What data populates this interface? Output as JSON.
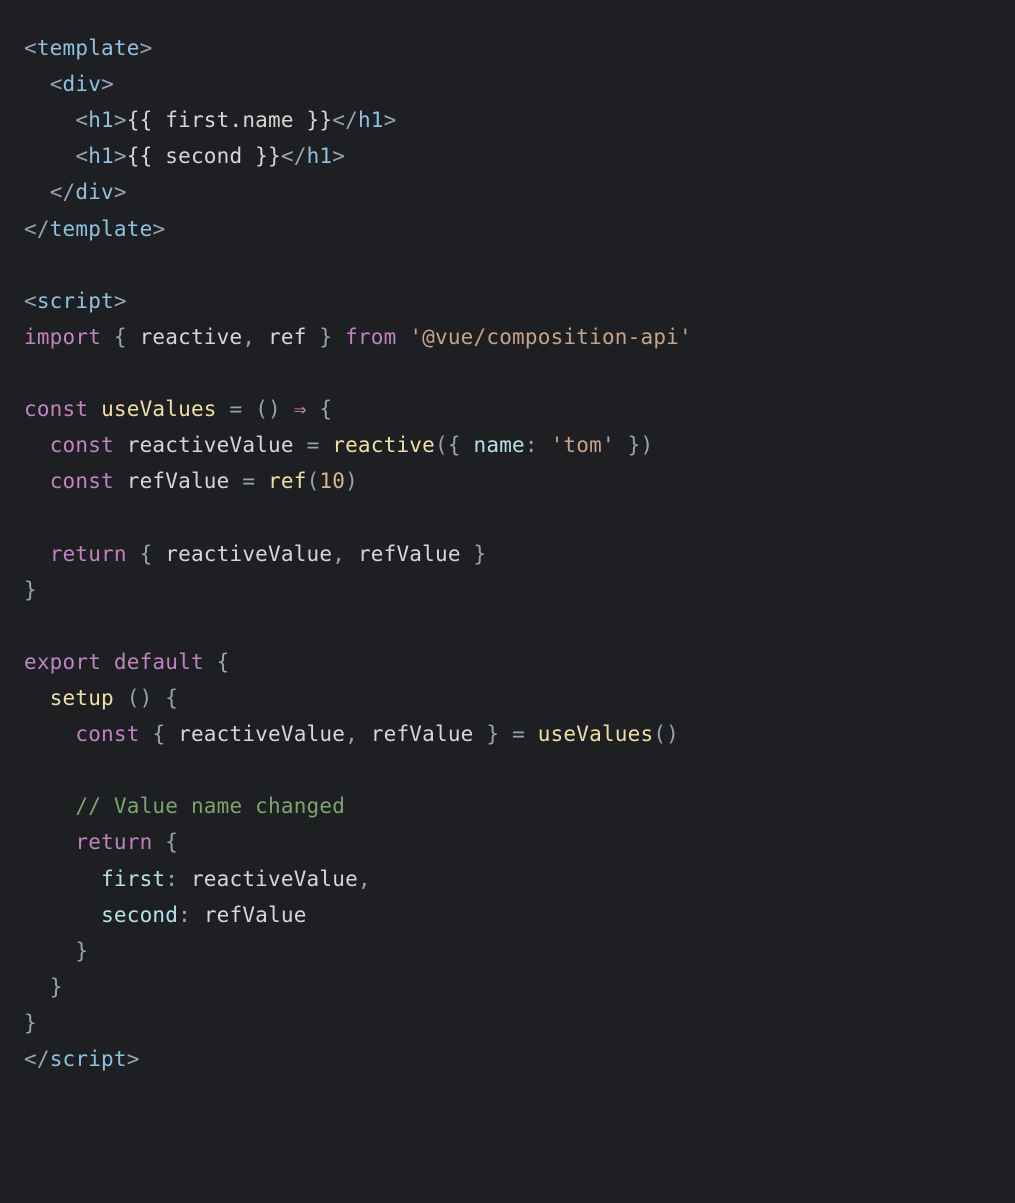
{
  "code": {
    "l1": {
      "p1": "<",
      "t1": "template",
      "p2": ">"
    },
    "l2": {
      "indent": "  ",
      "p1": "<",
      "t1": "div",
      "p2": ">"
    },
    "l3": {
      "indent": "    ",
      "p1": "<",
      "t1": "h1",
      "p2": ">",
      "m1": "{{ ",
      "v1": "first.name",
      "m2": " }}",
      "p3": "</",
      "t2": "h1",
      "p4": ">"
    },
    "l4": {
      "indent": "    ",
      "p1": "<",
      "t1": "h1",
      "p2": ">",
      "m1": "{{ ",
      "v1": "second",
      "m2": " }}",
      "p3": "</",
      "t2": "h1",
      "p4": ">"
    },
    "l5": {
      "indent": "  ",
      "p1": "</",
      "t1": "div",
      "p2": ">"
    },
    "l6": {
      "p1": "</",
      "t1": "template",
      "p2": ">"
    },
    "blank1": "",
    "l7": {
      "p1": "<",
      "t1": "script",
      "p2": ">"
    },
    "l8": {
      "kw": "import",
      "sp": " ",
      "p1": "{ ",
      "n1": "reactive",
      "c": ", ",
      "n2": "ref",
      "p2": " } ",
      "kw2": "from",
      "sp2": " ",
      "s": "'@vue/composition-api'"
    },
    "blank2": "",
    "l9": {
      "kw": "const",
      "sp": " ",
      "fn": "useValues",
      "sp2": " ",
      "op1": "=",
      "sp3": " ",
      "p1": "()",
      "sp4": " ",
      "arr": "⇒",
      "sp5": " ",
      "brace": "{"
    },
    "l10": {
      "indent": "  ",
      "kw": "const",
      "sp": " ",
      "id": "reactiveValue",
      "sp2": " ",
      "op": "=",
      "sp3": " ",
      "fn": "reactive",
      "p1": "({ ",
      "prop": "name",
      "p2": ": ",
      "str": "'tom'",
      "p3": " })"
    },
    "l11": {
      "indent": "  ",
      "kw": "const",
      "sp": " ",
      "id": "refValue",
      "sp2": " ",
      "op": "=",
      "sp3": " ",
      "fn": "ref",
      "p1": "(",
      "num": "10",
      "p2": ")"
    },
    "blank3": "",
    "l12": {
      "indent": "  ",
      "kw": "return",
      "sp": " ",
      "p1": "{ ",
      "n1": "reactiveValue",
      "c1": ", ",
      "n2": "refValue",
      "p2": " }"
    },
    "l13": {
      "p": "}"
    },
    "blank4": "",
    "l14": {
      "kw": "export",
      "sp": " ",
      "kw2": "default",
      "sp2": " ",
      "p": "{"
    },
    "l15": {
      "indent": "  ",
      "fn": "setup",
      "sp": " ",
      "p": "() {"
    },
    "l16": {
      "indent": "    ",
      "kw": "const",
      "sp": " ",
      "p1": "{ ",
      "n1": "reactiveValue",
      "c1": ", ",
      "n2": "refValue",
      "p2": " } ",
      "op": "=",
      "sp2": " ",
      "fn": "useValues",
      "p3": "()"
    },
    "blank5": "",
    "l17": {
      "indent": "    ",
      "c": "// Value name changed"
    },
    "l18": {
      "indent": "    ",
      "kw": "return",
      "sp": " ",
      "p": "{"
    },
    "l19": {
      "indent": "      ",
      "prop": "first",
      "p": ": ",
      "id": "reactiveValue",
      "c": ","
    },
    "l20": {
      "indent": "      ",
      "prop": "second",
      "p": ": ",
      "id": "refValue"
    },
    "l21": {
      "indent": "    ",
      "p": "}"
    },
    "l22": {
      "indent": "  ",
      "p": "}"
    },
    "l23": {
      "p": "}"
    },
    "l24": {
      "p1": "</",
      "t1": "script",
      "p2": ">"
    }
  }
}
